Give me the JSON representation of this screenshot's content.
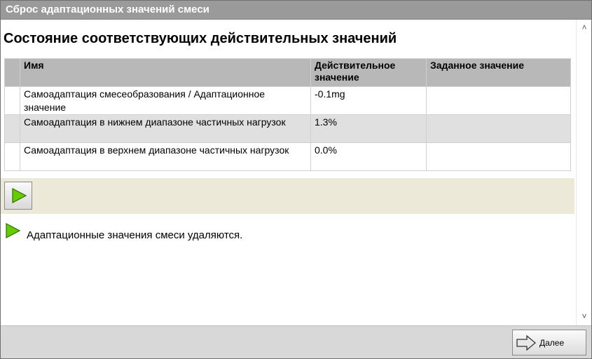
{
  "window": {
    "title": "Сброс адаптационных значений смеси"
  },
  "main": {
    "heading": "Состояние соответствующих действительных значений",
    "table": {
      "headers": [
        "Имя",
        "Действительное значение",
        "Заданное значение"
      ],
      "rows": [
        {
          "name": "Самоадаптация смесеобразования  / Адаптационное значение",
          "actual": "-0.1mg",
          "target": ""
        },
        {
          "name": "Самоадаптация в нижнем диапазоне частичных нагрузок",
          "actual": "1.3%",
          "target": ""
        },
        {
          "name": "Самоадаптация в верхнем диапазоне частичных нагрузок",
          "actual": "0.0%",
          "target": ""
        }
      ]
    },
    "toolbar": {
      "play_icon": "play-icon"
    },
    "status": {
      "icon": "play-icon",
      "text": "Адаптационные значения смеси удаляются."
    }
  },
  "scrollbar": {
    "up_glyph": "˄",
    "down_glyph": "˅"
  },
  "footer": {
    "next_label": "Далее",
    "next_icon": "arrow-right-icon"
  },
  "colors": {
    "play_green": "#66cc00",
    "titlebar": "#9a9a9a",
    "toolbar_bg": "#ece9d8",
    "header_bg": "#b8b8b8",
    "alt_row": "#e0e0e0"
  }
}
